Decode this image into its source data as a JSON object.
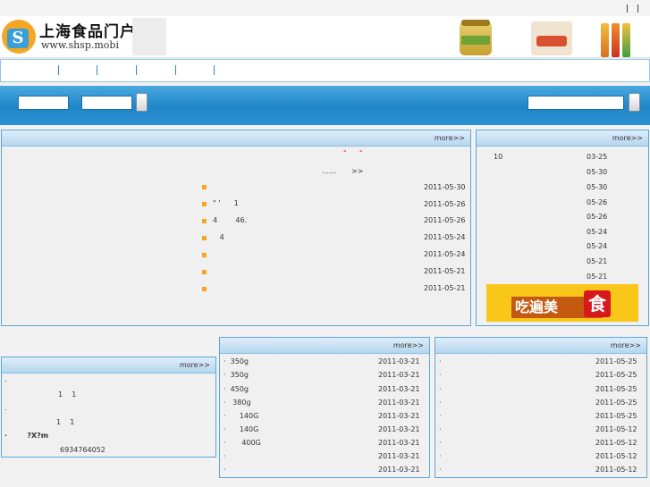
{
  "header": {
    "site_name": "上海食品门户",
    "site_url": "www.shsp.mobi"
  },
  "banner": {
    "text": "吃遍美",
    "highlight": "食"
  },
  "news_panel": {
    "more": "more>>",
    "quote_left": "\"",
    "quote_right": "\"",
    "ellipsis": "……",
    "arrow": ">>",
    "items": [
      {
        "title": "",
        "date": "2011-05-30"
      },
      {
        "title": "\" '      1",
        "date": "2011-05-26"
      },
      {
        "title": "4        46.",
        "date": "2011-05-26"
      },
      {
        "title": "   4",
        "date": "2011-05-24"
      },
      {
        "title": "",
        "date": "2011-05-24"
      },
      {
        "title": "",
        "date": "2011-05-21"
      },
      {
        "title": "",
        "date": "2011-05-21"
      }
    ]
  },
  "side_panel": {
    "more": "more>>",
    "items": [
      {
        "title": "10",
        "date": "03-25"
      },
      {
        "title": "",
        "date": "05-30"
      },
      {
        "title": "",
        "date": "05-30"
      },
      {
        "title": "",
        "date": "05-26"
      },
      {
        "title": "",
        "date": "05-26"
      },
      {
        "title": "",
        "date": "05-24"
      },
      {
        "title": "",
        "date": "05-24"
      },
      {
        "title": "",
        "date": "05-21"
      },
      {
        "title": "",
        "date": "05-21"
      }
    ]
  },
  "contact_panel": {
    "more": "more>>",
    "lines": [
      ".",
      "1    1",
      ".",
      "1    1",
      "·        ?X?m",
      "6934764052"
    ]
  },
  "products_panel": {
    "more": "more>>",
    "items": [
      {
        "title": "·  350g",
        "date": "2011-03-21"
      },
      {
        "title": "·  350g",
        "date": "2011-03-21"
      },
      {
        "title": "·  450g",
        "date": "2011-03-21"
      },
      {
        "title": "·   380g",
        "date": "2011-03-21"
      },
      {
        "title": "·      140G",
        "date": "2011-03-21"
      },
      {
        "title": "·      140G",
        "date": "2011-03-21"
      },
      {
        "title": "·       400G",
        "date": "2011-03-21"
      },
      {
        "title": "·",
        "date": "2011-03-21"
      },
      {
        "title": "·",
        "date": "2011-03-21"
      }
    ]
  },
  "right_panel": {
    "more": "more>>",
    "items": [
      {
        "title": "·",
        "date": "2011-05-25"
      },
      {
        "title": "·",
        "date": "2011-05-25"
      },
      {
        "title": "·",
        "date": "2011-05-25"
      },
      {
        "title": "·",
        "date": "2011-05-25"
      },
      {
        "title": "·",
        "date": "2011-05-25"
      },
      {
        "title": "·",
        "date": "2011-05-12"
      },
      {
        "title": "·",
        "date": "2011-05-12"
      },
      {
        "title": "·",
        "date": "2011-05-12"
      },
      {
        "title": "·",
        "date": "2011-05-12"
      }
    ]
  }
}
